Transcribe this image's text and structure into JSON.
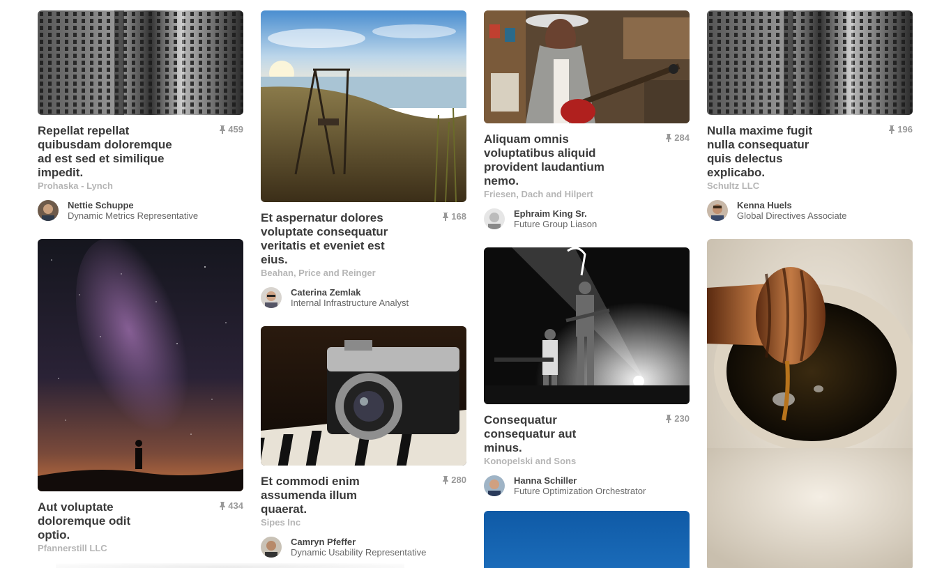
{
  "columns": [
    {
      "cards": [
        {
          "image": "Black-and-white skyscraper facade",
          "title": "Repellat repellat quibusdam doloremque ad est sed et similique impedit.",
          "pins": "459",
          "company": "Prohaska - Lynch",
          "author_name": "Nettie Schuppe",
          "author_role": "Dynamic Metrics Representative"
        },
        {
          "image": "Milky way night sky with silhouette",
          "title": "Aut voluptate doloremque odit optio.",
          "pins": "434",
          "company": "Pfannerstill LLC"
        }
      ]
    },
    {
      "cards": [
        {
          "image": "Swing by the lake at sunset",
          "title": "Et aspernatur dolores voluptate consequatur veritatis et eveniet est eius.",
          "pins": "168",
          "company": "Beahan, Price and Reinger",
          "author_name": "Caterina Zemlak",
          "author_role": "Internal Infrastructure Analyst"
        },
        {
          "image": "Vintage camera on piano keys",
          "title": "Et commodi enim assumenda illum quaerat.",
          "pins": "280",
          "company": "Sipes Inc",
          "author_name": "Camryn Pfeffer",
          "author_role": "Dynamic Usability Representative"
        }
      ]
    },
    {
      "cards": [
        {
          "image": "Woman with guitar in record store",
          "title": "Aliquam omnis voluptatibus aliquid provident laudantium nemo.",
          "pins": "284",
          "company": "Friesen, Dach and Hilpert",
          "author_name": "Ephraim King Sr.",
          "author_role": "Future Group Liason"
        },
        {
          "image": "Band performing on stage",
          "title": "Consequatur consequatur aut minus.",
          "pins": "230",
          "company": "Konopelski and Sons",
          "author_name": "Hanna Schiller",
          "author_role": "Future Optimization Orchestrator"
        },
        {
          "image": "Blue sky"
        }
      ]
    },
    {
      "cards": [
        {
          "image": "Black-and-white skyscraper facade",
          "title": "Nulla maxime fugit nulla consequatur quis delectus explicabo.",
          "pins": "196",
          "company": "Schultz LLC",
          "author_name": "Kenna Huels",
          "author_role": "Global Directives Associate"
        },
        {
          "image": "Honey dipper in honey jar"
        }
      ]
    }
  ],
  "colors": {
    "title": "#3a3a3a",
    "company": "#b5b5b5",
    "pins": "#9a9a9a"
  },
  "icons": {
    "pin": "pushpin-icon"
  }
}
